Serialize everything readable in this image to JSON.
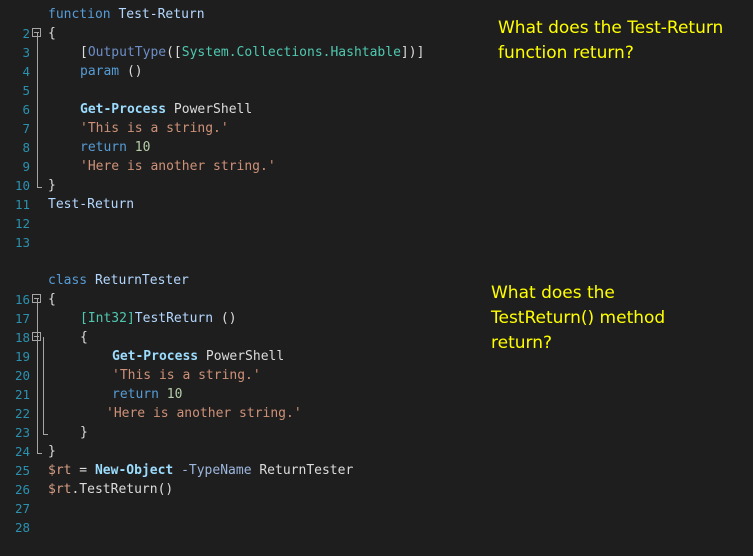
{
  "questions": {
    "q1": "What does the Test-Return\nfunction return?",
    "q2": "What does the\nTestReturn() method\nreturn?"
  },
  "block1": {
    "line_numbers": [
      "2",
      "3",
      "4",
      "5",
      "6",
      "7",
      "8",
      "9",
      "10",
      "11",
      "12",
      "13"
    ],
    "l2": {
      "kw": "function",
      "name": "Test-Return"
    },
    "l3": {
      "brace": "{"
    },
    "l4": {
      "open": "[",
      "attr": "OutputType",
      "paren": "([",
      "type": "System.Collections.Hashtable",
      "close": "])]"
    },
    "l5": {
      "kw": "param",
      "rest": " ()"
    },
    "l7": {
      "cmd": "Get-Process",
      "arg": " PowerShell"
    },
    "l8": {
      "str": "'This is a string.'"
    },
    "l9": {
      "kw": "return",
      "num": " 10"
    },
    "l10": {
      "str": "'Here is another string.'"
    },
    "l11": {
      "brace": "}"
    },
    "l12": {
      "name": "Test-Return"
    }
  },
  "block2": {
    "line_numbers": [
      "16",
      "17",
      "18",
      "19",
      "20",
      "21",
      "22",
      "23",
      "24",
      "25",
      "26",
      "27",
      "28"
    ],
    "l16": {
      "kw": "class",
      "name": " ReturnTester"
    },
    "l17": {
      "brace": "{"
    },
    "l18": {
      "type": "[Int32]",
      "method": "TestReturn",
      "rest": " ()"
    },
    "l19": {
      "brace": "{"
    },
    "l20": {
      "cmd": "Get-Process",
      "arg": " PowerShell"
    },
    "l21": {
      "str": "'This is a string.'"
    },
    "l22": {
      "kw": "return",
      "num": " 10"
    },
    "l23": {
      "str": "'Here is another string.'"
    },
    "l24": {
      "brace": "}"
    },
    "l25": {
      "brace": "}"
    },
    "l26": {
      "var": "$rt",
      "eq": " = ",
      "cmd": "New-Object",
      "param": " -TypeName",
      "arg": " ReturnTester"
    },
    "l27": {
      "var": "$rt",
      "call": ".TestReturn()"
    }
  },
  "colors": {
    "background": "#1e1e1e",
    "line_number": "#2b91af",
    "keyword": "#569cd6",
    "string": "#ce9178",
    "question": "#ffff00"
  }
}
